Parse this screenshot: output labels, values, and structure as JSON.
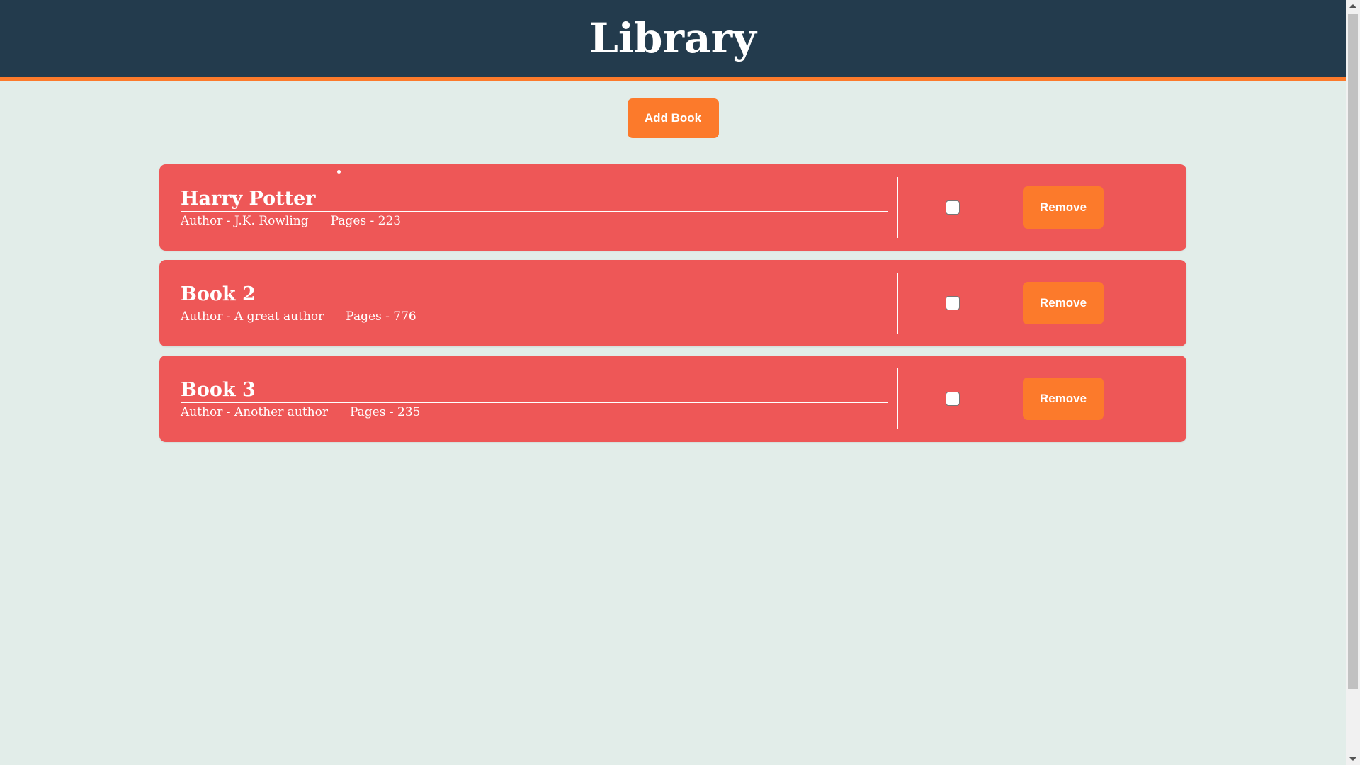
{
  "header": {
    "title": "Library"
  },
  "actions": {
    "add_label": "Add Book"
  },
  "books": [
    {
      "title": "Harry Potter",
      "author": "Author - J.K. Rowling",
      "pages": "Pages - 223",
      "read": false,
      "remove_label": "Remove"
    },
    {
      "title": "Book 2",
      "author": "Author - A great author",
      "pages": "Pages - 776",
      "read": false,
      "remove_label": "Remove"
    },
    {
      "title": "Book 3",
      "author": "Author - Another author",
      "pages": "Pages - 235",
      "read": false,
      "remove_label": "Remove"
    }
  ],
  "colors": {
    "header_bg": "#233b4d",
    "accent": "#fc7a2b",
    "card_bg": "#ee5757",
    "page_bg": "#e2ede9"
  }
}
